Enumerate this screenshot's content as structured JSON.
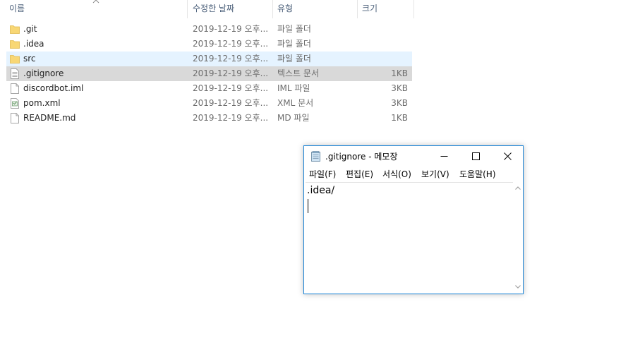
{
  "explorer": {
    "columns": {
      "name": "이름",
      "date": "수정한 날짜",
      "type": "유형",
      "size": "크기"
    },
    "rows": [
      {
        "name": ".git",
        "date": "2019-12-19 오후...",
        "type": "파일 폴더",
        "size": "",
        "icon": "folder-icon"
      },
      {
        "name": ".idea",
        "date": "2019-12-19 오후...",
        "type": "파일 폴더",
        "size": "",
        "icon": "folder-icon"
      },
      {
        "name": "src",
        "date": "2019-12-19 오후...",
        "type": "파일 폴더",
        "size": "",
        "icon": "folder-icon"
      },
      {
        "name": ".gitignore",
        "date": "2019-12-19 오후...",
        "type": "텍스트 문서",
        "size": "1KB",
        "icon": "text-file-icon"
      },
      {
        "name": "discordbot.iml",
        "date": "2019-12-19 오후...",
        "type": "IML 파일",
        "size": "3KB",
        "icon": "file-icon"
      },
      {
        "name": "pom.xml",
        "date": "2019-12-19 오후...",
        "type": "XML 문서",
        "size": "3KB",
        "icon": "xml-file-icon"
      },
      {
        "name": "README.md",
        "date": "2019-12-19 오후...",
        "type": "MD 파일",
        "size": "1KB",
        "icon": "file-icon"
      }
    ]
  },
  "notepad": {
    "title": ".gitignore - 메모장",
    "menu": [
      "파일(F)",
      "편집(E)",
      "서식(O)",
      "보기(V)",
      "도움말(H)"
    ],
    "content": ".idea/"
  },
  "colors": {
    "accent_border": "#1883d7",
    "hover_row": "#e5f3ff",
    "selected_row": "#d9d9d9",
    "folder": "#f8d775",
    "header_text": "#4c607a"
  }
}
